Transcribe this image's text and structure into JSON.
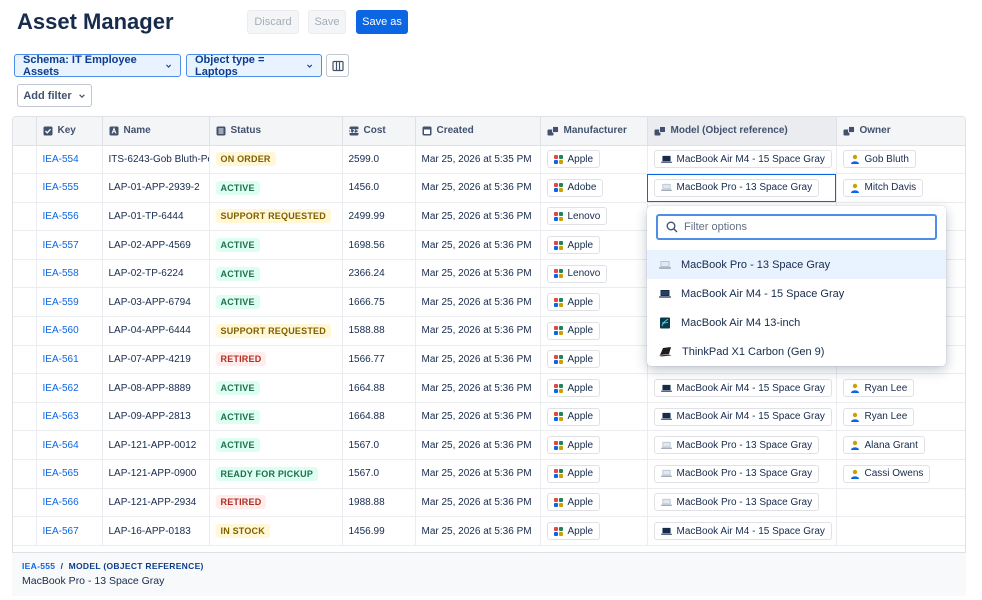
{
  "header": {
    "title": "Asset Manager",
    "discard_label": "Discard",
    "save_label": "Save",
    "save_as_label": "Save as"
  },
  "filters": {
    "schema_label": "Schema: IT Employee Assets",
    "object_type_label": "Object type = Laptops",
    "add_filter_label": "Add filter"
  },
  "table": {
    "columns": [
      "Key",
      "Name",
      "Status",
      "Cost",
      "Created",
      "Manufacturer",
      "Model (Object reference)",
      "Owner"
    ],
    "rows": [
      {
        "key": "IEA-554",
        "name": "ITS-6243-Gob Bluth-Pe",
        "status": "ON ORDER",
        "cost": "2599.0",
        "created": "Mar 25, 2026 at 5:35 PM",
        "manufacturer": "Apple",
        "model": "MacBook Air M4 - 15 Space Gray",
        "owner": "Gob Bluth"
      },
      {
        "key": "IEA-555",
        "name": "LAP-01-APP-2939-2",
        "status": "ACTIVE",
        "cost": "1456.0",
        "created": "Mar 25, 2026 at 5:36 PM",
        "manufacturer": "Adobe",
        "model": "MacBook Pro - 13 Space Gray",
        "owner": "Mitch Davis"
      },
      {
        "key": "IEA-556",
        "name": "LAP-01-TP-6444",
        "status": "SUPPORT REQUESTED",
        "cost": "2499.99",
        "created": "Mar 25, 2026 at 5:36 PM",
        "manufacturer": "Lenovo",
        "model": "",
        "owner": ""
      },
      {
        "key": "IEA-557",
        "name": "LAP-02-APP-4569",
        "status": "ACTIVE",
        "cost": "1698.56",
        "created": "Mar 25, 2026 at 5:36 PM",
        "manufacturer": "Apple",
        "model": "",
        "owner": ""
      },
      {
        "key": "IEA-558",
        "name": "LAP-02-TP-6224",
        "status": "ACTIVE",
        "cost": "2366.24",
        "created": "Mar 25, 2026 at 5:36 PM",
        "manufacturer": "Lenovo",
        "model": "",
        "owner": ""
      },
      {
        "key": "IEA-559",
        "name": "LAP-03-APP-6794",
        "status": "ACTIVE",
        "cost": "1666.75",
        "created": "Mar 25, 2026 at 5:36 PM",
        "manufacturer": "Apple",
        "model": "",
        "owner": ""
      },
      {
        "key": "IEA-560",
        "name": "LAP-04-APP-6444",
        "status": "SUPPORT REQUESTED",
        "cost": "1588.88",
        "created": "Mar 25, 2026 at 5:36 PM",
        "manufacturer": "Apple",
        "model": "",
        "owner": ""
      },
      {
        "key": "IEA-561",
        "name": "LAP-07-APP-4219",
        "status": "RETIRED",
        "cost": "1566.77",
        "created": "Mar 25, 2026 at 5:36 PM",
        "manufacturer": "Apple",
        "model": "",
        "owner": ""
      },
      {
        "key": "IEA-562",
        "name": "LAP-08-APP-8889",
        "status": "ACTIVE",
        "cost": "1664.88",
        "created": "Mar 25, 2026 at 5:36 PM",
        "manufacturer": "Apple",
        "model": "MacBook Air M4 - 15 Space Gray",
        "owner": "Ryan Lee"
      },
      {
        "key": "IEA-563",
        "name": "LAP-09-APP-2813",
        "status": "ACTIVE",
        "cost": "1664.88",
        "created": "Mar 25, 2026 at 5:36 PM",
        "manufacturer": "Apple",
        "model": "MacBook Air M4 - 15 Space Gray",
        "owner": "Ryan Lee"
      },
      {
        "key": "IEA-564",
        "name": "LAP-121-APP-0012",
        "status": "ACTIVE",
        "cost": "1567.0",
        "created": "Mar 25, 2026 at 5:36 PM",
        "manufacturer": "Apple",
        "model": "MacBook Pro - 13 Space Gray",
        "owner": "Alana Grant"
      },
      {
        "key": "IEA-565",
        "name": "LAP-121-APP-0900",
        "status": "READY FOR PICKUP",
        "cost": "1567.0",
        "created": "Mar 25, 2026 at 5:36 PM",
        "manufacturer": "Apple",
        "model": "MacBook Pro - 13 Space Gray",
        "owner": "Cassi Owens"
      },
      {
        "key": "IEA-566",
        "name": "LAP-121-APP-2934",
        "status": "RETIRED",
        "cost": "1988.88",
        "created": "Mar 25, 2026 at 5:36 PM",
        "manufacturer": "Apple",
        "model": "MacBook Pro - 13 Space Gray",
        "owner": ""
      },
      {
        "key": "IEA-567",
        "name": "LAP-16-APP-0183",
        "status": "IN STOCK",
        "cost": "1456.99",
        "created": "Mar 25, 2026 at 5:36 PM",
        "manufacturer": "Apple",
        "model": "MacBook Air M4 - 15 Space Gray",
        "owner": ""
      }
    ]
  },
  "footer": {
    "key": "IEA-555",
    "field": "MODEL (OBJECT REFERENCE)",
    "value": "MacBook Pro - 13 Space Gray"
  },
  "dropdown": {
    "placeholder": "Filter options",
    "options": [
      {
        "label": "MacBook Pro - 13 Space Gray",
        "icon": "laptop-silver-icon"
      },
      {
        "label": "MacBook Air M4 - 15 Space Gray",
        "icon": "laptop-dark-icon"
      },
      {
        "label": "MacBook Air M4 13-inch",
        "icon": "laptop-wallpaper-icon"
      },
      {
        "label": "ThinkPad X1 Carbon (Gen 9)",
        "icon": "thinkpad-icon"
      }
    ]
  },
  "colors": {
    "primary": "#0c66e4",
    "filter_chip_bg": "#e9f2ff",
    "active_green": "#216e4e",
    "retired_red": "#ae2e24",
    "warning_yellow": "#7f5f01"
  }
}
